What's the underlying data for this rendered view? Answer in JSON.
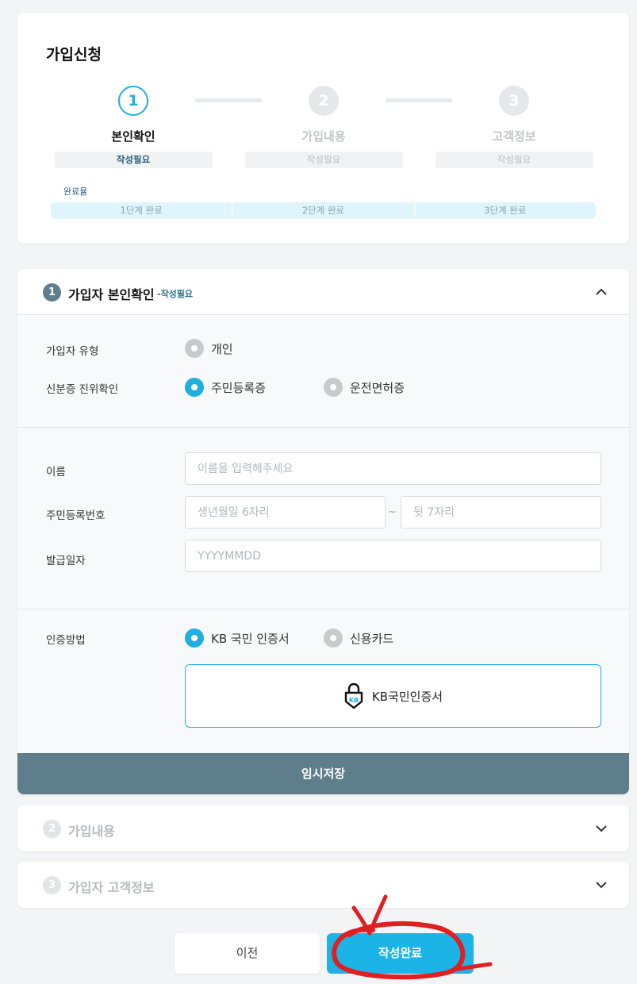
{
  "page": {
    "title": "가입신청"
  },
  "steps": [
    {
      "num": "1",
      "name": "본인확인",
      "badge": "작성필요"
    },
    {
      "num": "2",
      "name": "가입내용",
      "badge": "작성필요"
    },
    {
      "num": "3",
      "name": "고객정보",
      "badge": "작성필요"
    }
  ],
  "progress": {
    "label": "완료율",
    "segments": [
      "1단계 완료",
      "2단계 완료",
      "3단계 완료"
    ]
  },
  "section1": {
    "num": "1",
    "title": "가입자 본인확인",
    "status": "-작성필요",
    "member_type_label": "가입자 유형",
    "member_type_option": "개인",
    "id_verify_label": "신분증 진위확인",
    "id_option_1": "주민등록증",
    "id_option_2": "운전면허증",
    "name_label": "이름",
    "name_placeholder": "이름을 입력헤주세요",
    "rrn_label": "주민등록번호",
    "rrn_front_placeholder": "생년월일 6자리",
    "rrn_tilde": "~",
    "rrn_back_placeholder": "뒷 7자리",
    "issue_date_label": "발급일자",
    "issue_date_placeholder": "YYYYMMDD",
    "auth_label": "인증방법",
    "auth_option_1": "KB 국민 인증서",
    "auth_option_2": "신용카드",
    "cert_button_label": "KB국민인증서",
    "cert_icon_text": "KB",
    "save_label": "임시저장"
  },
  "section2": {
    "num": "2",
    "title": "가입내용"
  },
  "section3": {
    "num": "3",
    "title": "가입자 고객정보"
  },
  "buttons": {
    "prev": "이전",
    "done": "작성완료"
  },
  "colors": {
    "accent": "#1cb3e6",
    "section_header": "#5f7e8c",
    "annotation": "#e02020"
  }
}
